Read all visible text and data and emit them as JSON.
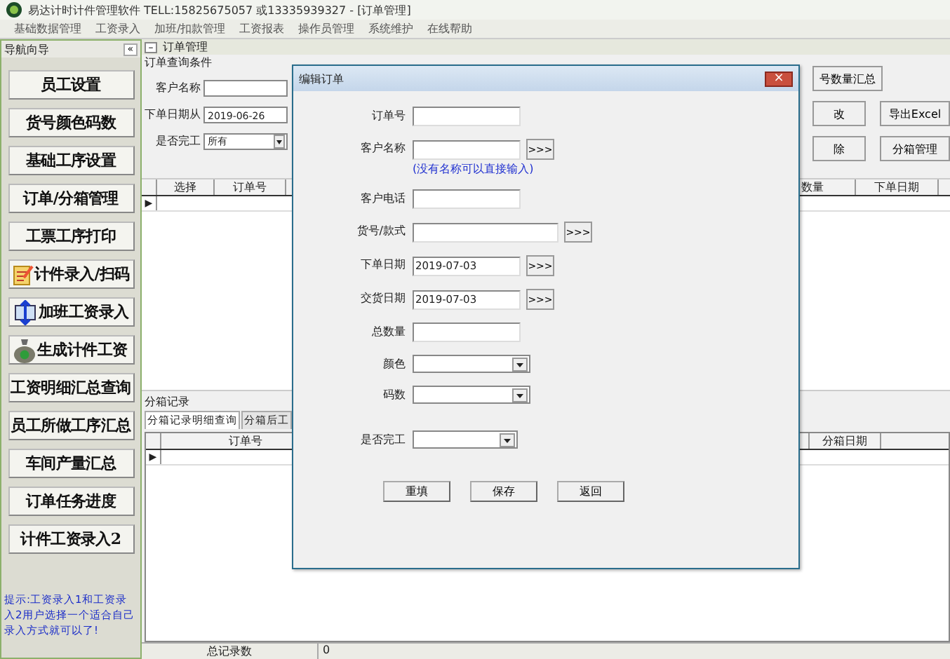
{
  "window": {
    "title": "易达计时计件管理软件   TELL:15825675057 或13335939327 - [订单管理]"
  },
  "menu": [
    "基础数据管理",
    "工资录入",
    "加班/扣款管理",
    "工资报表",
    "操作员管理",
    "系统维护",
    "在线帮助"
  ],
  "sidebar": {
    "title": "导航向导",
    "collapse": "«",
    "items": [
      {
        "label": "员工设置",
        "kind": "plain"
      },
      {
        "label": "货号颜色码数",
        "kind": "plain"
      },
      {
        "label": "基础工序设置",
        "kind": "plain"
      },
      {
        "label": "订单/分箱管理",
        "kind": "plain"
      },
      {
        "label": "工票工序打印",
        "kind": "plain"
      },
      {
        "label": "计件录入/扫码",
        "kind": "icon"
      },
      {
        "label": "加班工资录入",
        "kind": "icon"
      },
      {
        "label": "生成计件工资",
        "kind": "icon"
      },
      {
        "label": "工资明细汇总查询",
        "kind": "plain"
      },
      {
        "label": "员工所做工序汇总",
        "kind": "plain"
      },
      {
        "label": "车间产量汇总",
        "kind": "plain"
      },
      {
        "label": "订单任务进度",
        "kind": "plain"
      },
      {
        "label": "计件工资录入2",
        "kind": "plain"
      }
    ],
    "hint": "提示:工资录入1和工资录入2用户选择一个适合自己录入方式就可以了!"
  },
  "child_window": {
    "title": "订单管理",
    "control": "–"
  },
  "query": {
    "group_title": "订单查询条件",
    "fields": [
      {
        "label": "客户名称",
        "kind": "text"
      },
      {
        "label": "下单日期从",
        "value": "2019-06-26",
        "kind": "text"
      },
      {
        "label": "是否完工",
        "value": "所有",
        "kind": "combo"
      }
    ],
    "buttons": [
      [
        "号数量汇总"
      ],
      [
        "改",
        "导出Excel"
      ],
      [
        "除",
        "分箱管理"
      ]
    ]
  },
  "orders_table": {
    "columns": [
      "选择",
      "订单号",
      "数量",
      "下单日期"
    ],
    "row_marker": "▶"
  },
  "boxes": {
    "group_title": "分箱记录",
    "tabs": [
      {
        "label": "分箱记录明细查询",
        "selected": true
      },
      {
        "label": "分箱后工",
        "selected": false
      }
    ],
    "columns": [
      "订单号",
      "分箱日期"
    ],
    "row_marker": "▶"
  },
  "footer": {
    "label": "总记录数",
    "value": "0"
  },
  "dialog": {
    "title": "编辑订单",
    "close": "×",
    "rows": [
      {
        "label": "订单号",
        "kind": "text"
      },
      {
        "label": "客户名称",
        "kind": "text_button",
        "button": ">>>",
        "hint": "(没有名称可以直接输入)"
      },
      {
        "label": "客户电话",
        "kind": "text"
      },
      {
        "label": "货号/款式",
        "kind": "wide_button",
        "button": ">>>"
      },
      {
        "label": "下单日期",
        "kind": "text_button",
        "value": "2019-07-03",
        "button": ">>>"
      },
      {
        "label": "交货日期",
        "kind": "text_button",
        "value": "2019-07-03",
        "button": ">>>"
      },
      {
        "label": "总数量",
        "kind": "text"
      },
      {
        "label": "颜色",
        "kind": "combo"
      },
      {
        "label": "码数",
        "kind": "combo"
      },
      {
        "label": "是否完工",
        "kind": "combo_short"
      }
    ],
    "buttons": [
      "重填",
      "保存",
      "返回"
    ]
  }
}
